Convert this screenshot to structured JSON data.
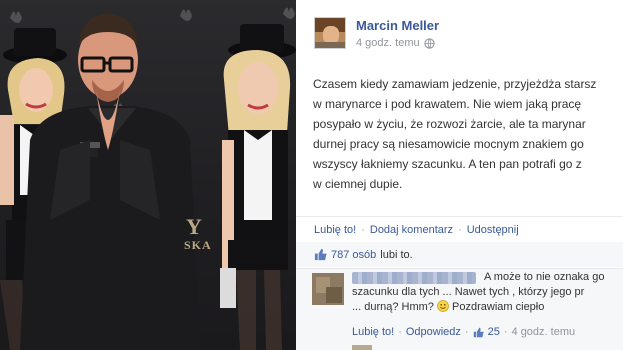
{
  "photo": {
    "description_visible_logo_fragment": "SKA",
    "logo_fragment_y": "Y"
  },
  "post": {
    "author": "Marcin Meller",
    "time": "4 godz. temu",
    "body_lines": [
      "Czasem kiedy zamawiam jedzenie, przyjeżdża starsz",
      "w marynarce i pod krawatem. Nie wiem jaką pracę",
      "posypało w życiu, że rozwozi żarcie, ale ta marynar",
      "durnej pracy są niesamowicie mocnym znakiem go",
      "wszyscy łakniemy szacunku. A ten pan potrafi go z",
      "w ciemnej dupie."
    ],
    "actions": {
      "like": "Lubię to!",
      "comment": "Dodaj komentarz",
      "share": "Udostępnij",
      "separator": "·"
    },
    "likes": {
      "count_label": "787 osób",
      "suffix": "lubi to."
    },
    "comment": {
      "line1": "A może to nie oznaka go",
      "line2": "szacunku dla tych ... Nawet tych , którzy jego pr",
      "line3": "... durną? Hmm?",
      "line3_tail": "Pozdrawiam ciepło",
      "like": "Lubię to!",
      "reply": "Odpowiedz",
      "like_count": "25",
      "time": "4 godz. temu",
      "separator": "·"
    }
  },
  "colors": {
    "link": "#3b5998",
    "text": "#333333",
    "muted": "#90949c",
    "feedback_bg": "#f6f7f9"
  }
}
